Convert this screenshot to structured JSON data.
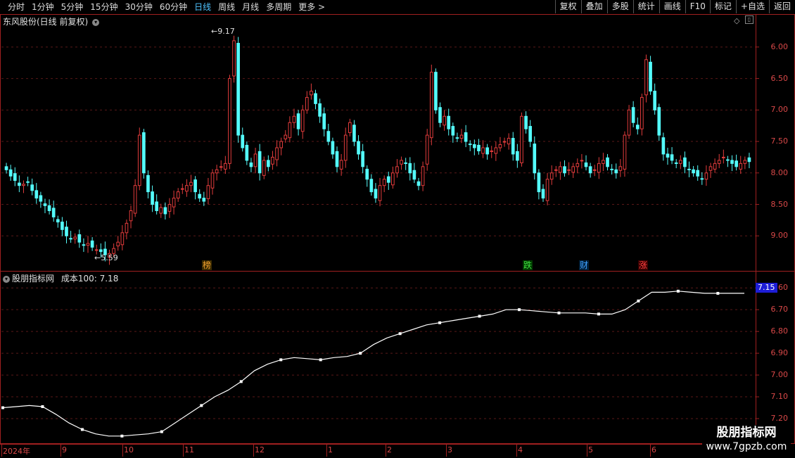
{
  "toolbar": {
    "periods": [
      "分时",
      "1分钟",
      "5分钟",
      "15分钟",
      "30分钟",
      "60分钟",
      "日线",
      "周线",
      "月线",
      "多周期",
      "更多"
    ],
    "active_index": 6,
    "more_arrow": ">",
    "right_buttons": [
      "复权",
      "叠加",
      "多股",
      "统计",
      "画线",
      "F10",
      "标记",
      "+自选",
      "返回"
    ]
  },
  "main_panel": {
    "title": "东风股份(日线 前复权)",
    "y_ticks": [
      "9.00",
      "8.50",
      "8.00",
      "7.50",
      "7.00",
      "6.50",
      "6.00"
    ],
    "high_label": "9.17",
    "low_label": "5.59",
    "events": [
      {
        "text": "榜",
        "color": "#f0a030",
        "bg": "#3a2a00"
      },
      {
        "text": "跌",
        "color": "#40e040",
        "bg": "#003a00"
      },
      {
        "text": "财",
        "color": "#40a0ff",
        "bg": "#00203a"
      },
      {
        "text": "涨",
        "color": "#ff4040",
        "bg": "#3a0000"
      }
    ]
  },
  "indicator_panel": {
    "title": "股朋指标网",
    "series_label": "成本100: 7.18",
    "y_ticks": [
      "7.20",
      "7.10",
      "7.00",
      "6.90",
      "6.80",
      "6.70",
      "6.60"
    ],
    "current_value": "7.15"
  },
  "x_axis": {
    "labels": [
      "2024年",
      "9",
      "10",
      "11",
      "12",
      "1",
      "2",
      "3",
      "4",
      "5",
      "6"
    ]
  },
  "watermark": {
    "line1": "股朋指标网",
    "line2": "www.7gpzb.com"
  },
  "colors": {
    "up": "#e23c3c",
    "down": "#54fcfc",
    "axis": "#d94848",
    "line": "#ffffff"
  },
  "chart_data": [
    {
      "type": "candlestick",
      "title": "东风股份(日线 前复权)",
      "ylim": [
        5.5,
        9.3
      ],
      "y_ticks": [
        6.0,
        6.5,
        7.0,
        7.5,
        8.0,
        8.5,
        9.0
      ],
      "x_labels": [
        "2024年",
        "9",
        "10",
        "11",
        "12",
        "1",
        "2",
        "3",
        "4",
        "5",
        "6"
      ],
      "annotations": {
        "max": 9.17,
        "min": 5.59
      },
      "closes": [
        7.05,
        6.95,
        6.88,
        6.8,
        6.82,
        6.85,
        6.72,
        6.6,
        6.55,
        6.48,
        6.4,
        6.3,
        6.22,
        6.1,
        6.0,
        5.95,
        5.98,
        5.9,
        5.85,
        5.88,
        5.82,
        5.78,
        5.75,
        5.7,
        5.72,
        5.8,
        5.9,
        6.05,
        6.2,
        6.4,
        6.8,
        7.6,
        7.0,
        6.7,
        6.5,
        6.4,
        6.45,
        6.35,
        6.5,
        6.6,
        6.7,
        6.75,
        6.8,
        6.85,
        6.7,
        6.6,
        6.55,
        6.8,
        7.0,
        7.05,
        7.1,
        7.15,
        8.5,
        9.1,
        7.6,
        7.4,
        7.2,
        7.1,
        7.3,
        7.0,
        7.2,
        7.1,
        7.25,
        7.4,
        7.5,
        7.6,
        7.8,
        7.9,
        7.7,
        8.0,
        8.2,
        8.3,
        8.1,
        7.9,
        7.7,
        7.5,
        7.3,
        7.1,
        7.2,
        7.6,
        7.8,
        7.5,
        7.3,
        7.1,
        6.9,
        6.7,
        6.6,
        6.8,
        6.9,
        6.85,
        7.0,
        7.1,
        7.2,
        7.15,
        7.0,
        6.9,
        6.8,
        7.1,
        7.6,
        8.6,
        8.0,
        7.8,
        7.9,
        7.7,
        7.6,
        7.55,
        7.6,
        7.5,
        7.45,
        7.4,
        7.35,
        7.4,
        7.3,
        7.35,
        7.4,
        7.45,
        7.5,
        7.55,
        7.3,
        7.2,
        7.9,
        7.7,
        7.5,
        7.0,
        6.7,
        6.6,
        6.9,
        7.0,
        7.05,
        7.1,
        7.0,
        7.05,
        7.1,
        7.15,
        7.2,
        7.1,
        7.0,
        7.05,
        7.15,
        7.2,
        7.1,
        7.05,
        7.0,
        7.1,
        7.6,
        8.0,
        7.8,
        7.7,
        8.2,
        8.8,
        8.3,
        8.0,
        7.6,
        7.3,
        7.25,
        7.2,
        7.15,
        7.2,
        7.1,
        7.05,
        7.0,
        6.95,
        6.9,
        7.0,
        7.1,
        7.15,
        7.2,
        7.25,
        7.2,
        7.15,
        7.1,
        7.15,
        7.2,
        7.18
      ]
    },
    {
      "type": "line",
      "title": "股朋指标网",
      "series": [
        {
          "name": "成本100",
          "values": [
            6.65,
            6.655,
            6.66,
            6.655,
            6.62,
            6.58,
            6.55,
            6.53,
            6.52,
            6.52,
            6.525,
            6.53,
            6.54,
            6.58,
            6.62,
            6.66,
            6.7,
            6.73,
            6.77,
            6.82,
            6.85,
            6.87,
            6.88,
            6.875,
            6.87,
            6.88,
            6.885,
            6.9,
            6.94,
            6.97,
            6.99,
            7.01,
            7.03,
            7.04,
            7.05,
            7.06,
            7.07,
            7.08,
            7.1,
            7.1,
            7.095,
            7.09,
            7.085,
            7.085,
            7.085,
            7.08,
            7.08,
            7.1,
            7.14,
            7.18,
            7.18,
            7.185,
            7.18,
            7.175,
            7.175,
            7.175,
            7.175
          ]
        }
      ],
      "ylim": [
        6.6,
        7.22
      ],
      "y_ticks": [
        6.6,
        6.7,
        6.8,
        6.9,
        7.0,
        7.1,
        7.2
      ],
      "current": 7.15
    }
  ]
}
